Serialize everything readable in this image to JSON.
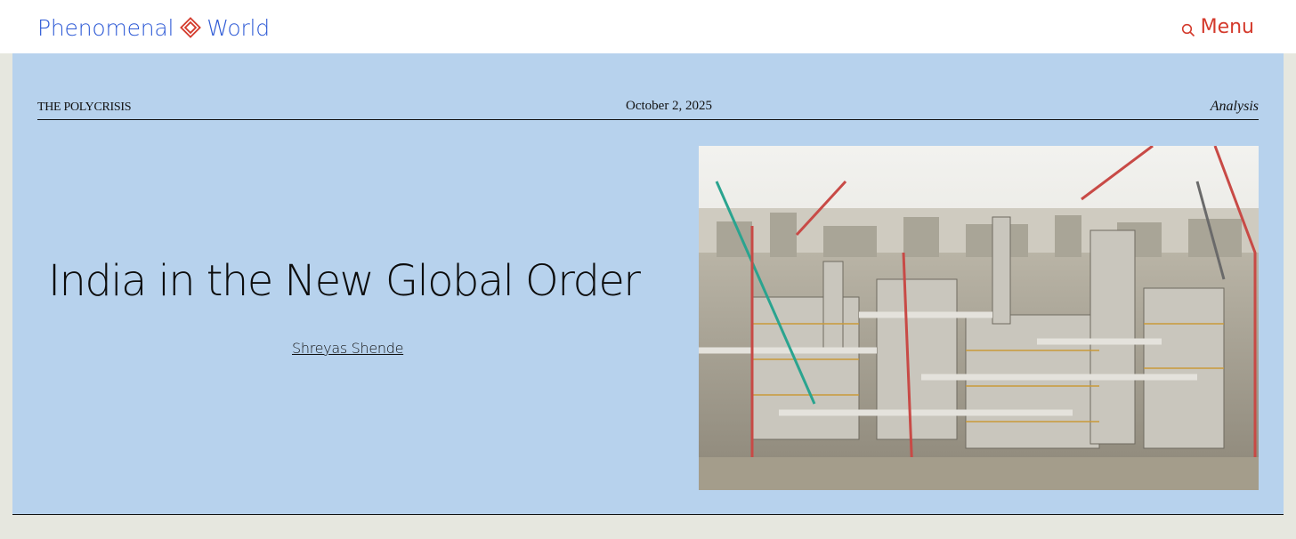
{
  "header": {
    "logo_left": "Phenomenal",
    "logo_right": "World",
    "logo_mark": "diamond-logo-icon",
    "menu_label": "Menu",
    "search_icon": "search-icon",
    "colors": {
      "brand_blue": "#2f5bd6",
      "brand_red": "#d43a2c"
    }
  },
  "article": {
    "series": "The Polycrisis",
    "date": "October 2, 2025",
    "category": "Analysis",
    "title": "India in the New Global Order",
    "author": "Shreyas Shende",
    "image_subject": "industrial-refinery-construction-photo",
    "colors": {
      "hero_background": "#b7d2ed",
      "page_background": "#e6e7df"
    }
  }
}
